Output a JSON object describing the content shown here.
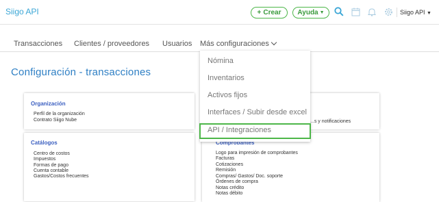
{
  "app": {
    "title": "Siigo API"
  },
  "topbar": {
    "crear_label": "Crear",
    "ayuda_label": "Ayuda",
    "user_label": "Siigo API"
  },
  "nav": {
    "items": [
      "Transacciones",
      "Clientes / proveedores",
      "Usuarios",
      "Más configuraciones"
    ]
  },
  "dropdown": {
    "items": [
      "Nómina",
      "Inventarios",
      "Activos fijos",
      "Interfaces / Subir desde excel",
      "API / Integraciones"
    ],
    "highlighted_index": 4,
    "highlight_color": "#4cb648"
  },
  "page": {
    "title": "Configuración - transacciones"
  },
  "cards": {
    "organizacion": {
      "title": "Organización",
      "links": [
        "Perfil de la organización",
        "Contrato Siigo Nube"
      ]
    },
    "catalogos": {
      "title": "Catálogos",
      "links": [
        "Centro de costos",
        "Impuestos",
        "Formas de pago",
        "Cuenta contable",
        "Gastos/Costos frecuentes"
      ]
    },
    "general_right": {
      "links": [
        "...s y notificaciones"
      ]
    },
    "comprobantes": {
      "title": "Comprobantes",
      "links": [
        "Logo para impresión de comprobantes",
        "Facturas",
        "Cotizaciones",
        "Remisión",
        "Compras/ Gastos/ Doc. soporte",
        "Órdenes de compra",
        "Notas crédito",
        "Notas débito"
      ]
    }
  },
  "colors": {
    "accent_green": "#4cb648",
    "brand_blue": "#3aa6d6",
    "title_blue": "#2e7fc4",
    "card_title_blue": "#3a5ec0"
  },
  "icons": [
    "search-icon",
    "calendar-icon",
    "bell-icon",
    "gear-icon",
    "plus-icon",
    "caret-down-icon"
  ]
}
